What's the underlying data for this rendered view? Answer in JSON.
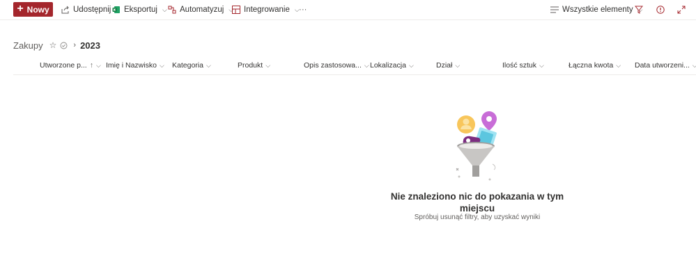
{
  "commandbar": {
    "new_label": "Nowy",
    "share_label": "Udostępnij",
    "export_label": "Eksportuj",
    "automate_label": "Automatyzuj",
    "integrate_label": "Integrowanie",
    "more_label": "···",
    "view_label": "Wszystkie elementy",
    "accent_color": "#a4262c"
  },
  "breadcrumb": {
    "root": "Zakupy",
    "current": "2023"
  },
  "columns": [
    {
      "label": "Utworzone p...",
      "sort": "↑"
    },
    {
      "label": "Imię i Nazwisko"
    },
    {
      "label": "Kategoria"
    },
    {
      "label": "Produkt"
    },
    {
      "label": "Opis zastosowa..."
    },
    {
      "label": "Lokalizacja"
    },
    {
      "label": "Dział"
    },
    {
      "label": "Ilość sztuk"
    },
    {
      "label": "Łączna kwota"
    },
    {
      "label": "Data utworzeni..."
    }
  ],
  "empty_state": {
    "title": "Nie znaleziono nic do pokazania w tym miejscu",
    "subtitle": "Spróbuj usunąć filtry, aby uzyskać wyniki"
  }
}
